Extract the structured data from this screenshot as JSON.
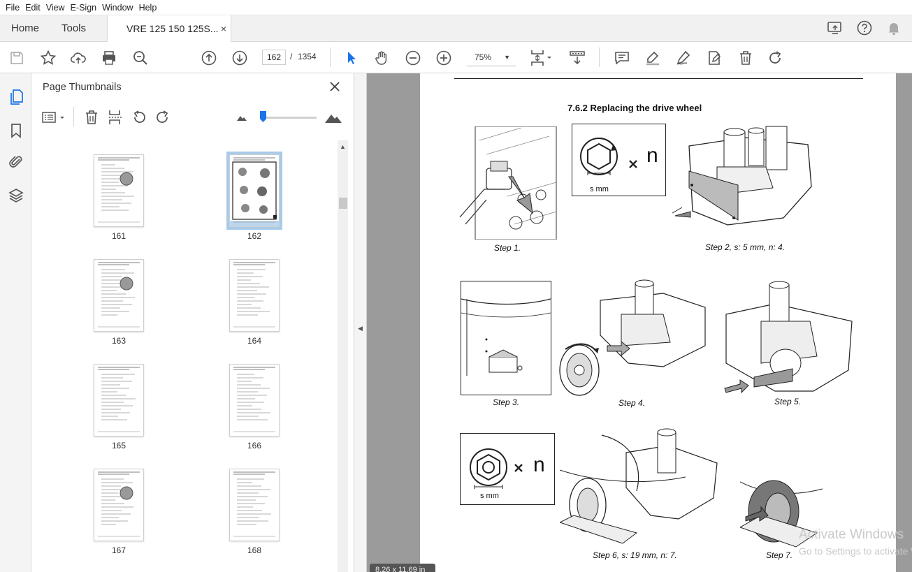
{
  "menu": [
    "File",
    "Edit",
    "View",
    "E-Sign",
    "Window",
    "Help"
  ],
  "tabs": {
    "home": "Home",
    "tools": "Tools",
    "document": "VRE 125 150 125S...",
    "close": "×"
  },
  "toolbar": {
    "page_current": "162",
    "page_sep": "/",
    "page_total": "1354",
    "zoom": "75%",
    "zoom_caret": "▼"
  },
  "panel": {
    "title": "Page Thumbnails",
    "thumbnails": [
      {
        "label": "161",
        "selected": false
      },
      {
        "label": "162",
        "selected": true
      },
      {
        "label": "163",
        "selected": false
      },
      {
        "label": "164",
        "selected": false
      },
      {
        "label": "165",
        "selected": false
      },
      {
        "label": "166",
        "selected": false
      },
      {
        "label": "167",
        "selected": false
      },
      {
        "label": "168",
        "selected": false
      }
    ]
  },
  "document": {
    "section_title": "7.6.2 Replacing the drive wheel",
    "captions": [
      "Step 1.",
      "Step 2, s: 5 mm, n: 4.",
      "Step 3.",
      "Step 4.",
      "Step 5.",
      "Step 6, s: 19 mm, n: 7.",
      "Step 7."
    ],
    "icon_labels": {
      "s_mm": "s mm",
      "times_n": "× n"
    }
  },
  "status": {
    "dimensions": "8.26 x 11.69 in"
  },
  "watermark": {
    "line1": "Activate Windows",
    "line2": "Go to Settings to activate Windows."
  },
  "colors": {
    "accent": "#1a73e8",
    "selected_thumb": "#bcd6ee",
    "doc_bg": "#9b9b9b"
  }
}
